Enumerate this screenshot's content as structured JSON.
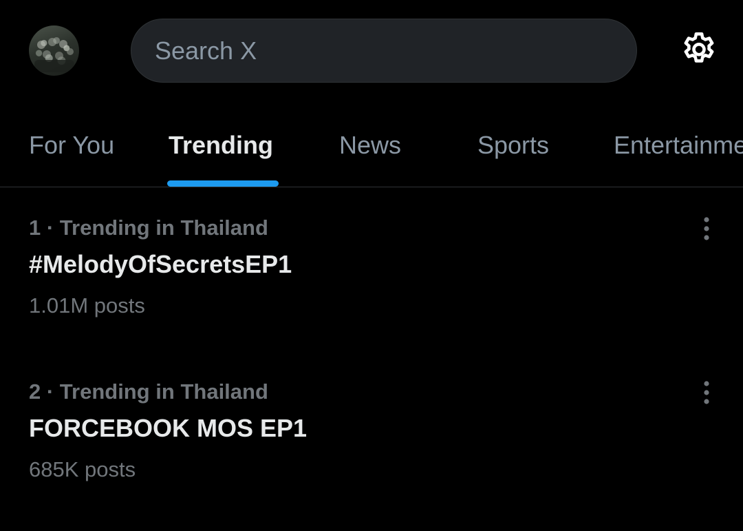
{
  "header": {
    "avatar_icon": "profile-avatar",
    "search_placeholder": "Search X",
    "settings_icon": "gear-icon"
  },
  "tabs": [
    {
      "label": "For You",
      "active": false
    },
    {
      "label": "Trending",
      "active": true
    },
    {
      "label": "News",
      "active": false
    },
    {
      "label": "Sports",
      "active": false
    },
    {
      "label": "Entertainment",
      "active": false
    }
  ],
  "trends": [
    {
      "rank": "1",
      "context": "Trending in Thailand",
      "meta": "1 · Trending in Thailand",
      "title": "#MelodyOfSecretsEP1",
      "posts": "1.01M posts",
      "more_icon": "more-vertical-icon"
    },
    {
      "rank": "2",
      "context": "Trending in Thailand",
      "meta": "2 · Trending in Thailand",
      "title": "FORCEBOOK MOS EP1",
      "posts": "685K posts",
      "more_icon": "more-vertical-icon"
    }
  ],
  "colors": {
    "background": "#000000",
    "search_bg": "#202327",
    "text_primary": "#e7e9ea",
    "text_secondary": "#71767b",
    "tab_inactive": "#8b98a5",
    "accent": "#1d9bf0",
    "divider": "#2f3336"
  }
}
